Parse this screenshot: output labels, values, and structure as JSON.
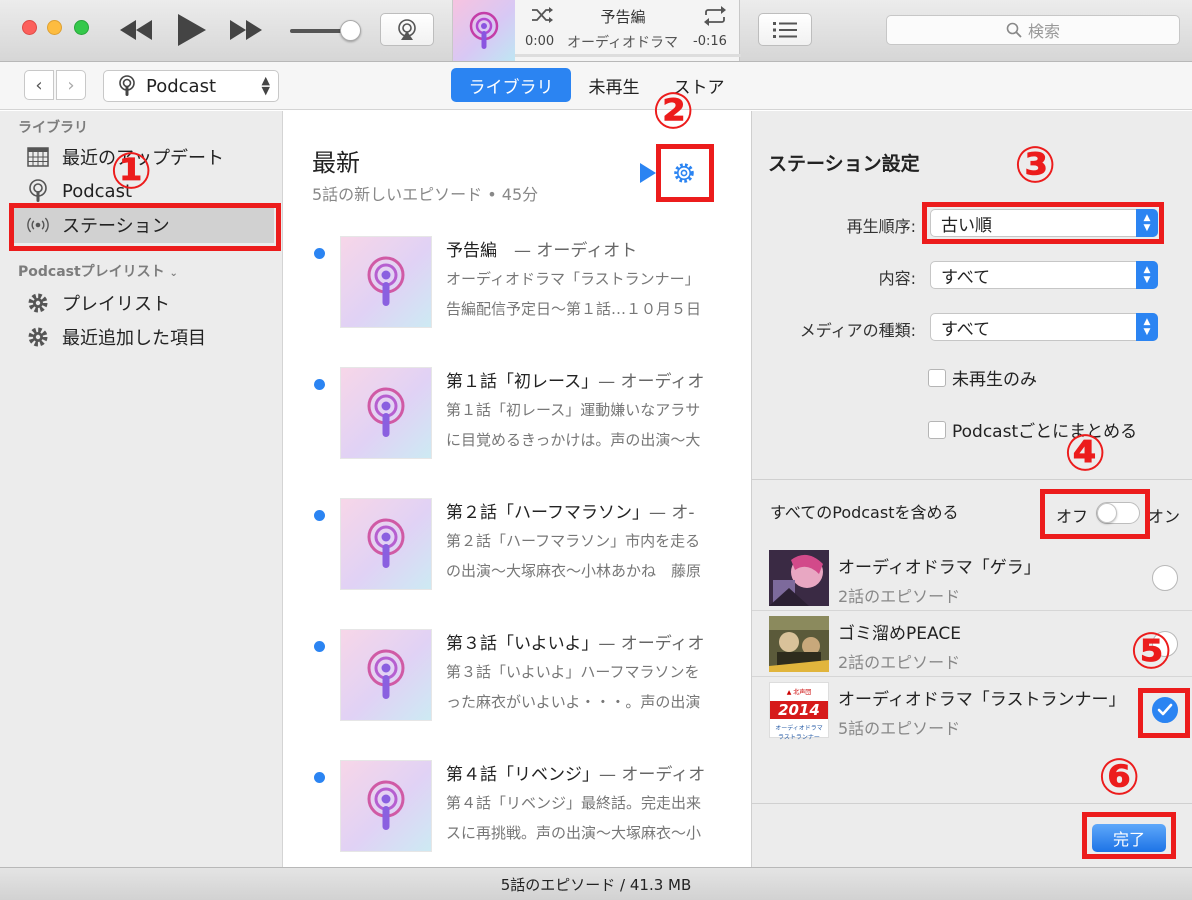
{
  "titlebar": {
    "lcd": {
      "title": "予告編",
      "subtitle": "オーディオドラマ",
      "time_elapsed": "0:00",
      "time_remaining": "-0:16",
      "progress": 0.0
    },
    "search_placeholder": "検索"
  },
  "navbar": {
    "media_type": "Podcast",
    "tabs": [
      {
        "label": "ライブラリ",
        "selected": true
      },
      {
        "label": "未再生",
        "selected": false
      },
      {
        "label": "ストア",
        "selected": false
      }
    ]
  },
  "sidebar": {
    "library_heading": "ライブラリ",
    "items": [
      {
        "label": "最近のアップデート",
        "icon": "calendar-grid-icon"
      },
      {
        "label": "Podcast",
        "icon": "podcast-icon"
      },
      {
        "label": "ステーション",
        "icon": "station-icon",
        "selected": true
      }
    ],
    "playlist_heading": "Podcastプレイリスト",
    "playlists": [
      {
        "label": "プレイリスト",
        "icon": "gear-icon"
      },
      {
        "label": "最近追加した項目",
        "icon": "gear-icon"
      }
    ]
  },
  "content": {
    "title": "最新",
    "subtitle": "5話の新しいエピソード • 45分",
    "episodes": [
      {
        "title": "予告編",
        "show": "— オーディオト",
        "desc1": "オーディオドラマ「ラストランナー」",
        "desc2": "告編配信予定日〜第１話…１０月５日"
      },
      {
        "title": "第１話「初レース」",
        "show": "— オーディオ",
        "desc1": "第１話「初レース」運動嫌いなアラサ",
        "desc2": "に目覚めるきっかけは。声の出演〜大"
      },
      {
        "title": "第２話「ハーフマラソン」",
        "show": "— オ-",
        "desc1": "第２話「ハーフマラソン」市内を走る",
        "desc2": "の出演〜大塚麻衣〜小林あかね　藤原"
      },
      {
        "title": "第３話「いよいよ」",
        "show": "— オーディオ",
        "desc1": "第３話「いよいよ」ハーフマラソンを",
        "desc2": "った麻衣がいよいよ・・・。声の出演"
      },
      {
        "title": "第４話「リベンジ」",
        "show": "— オーディオ",
        "desc1": "第４話「リベンジ」最終話。完走出来",
        "desc2": "スに再挑戦。声の出演〜大塚麻衣〜小"
      }
    ]
  },
  "panel": {
    "title": "ステーション設定",
    "fields": [
      {
        "label": "再生順序:",
        "value": "古い順"
      },
      {
        "label": "内容:",
        "value": "すべて"
      },
      {
        "label": "メディアの種類:",
        "value": "すべて"
      }
    ],
    "checkboxes": [
      {
        "label": "未再生のみ",
        "checked": false
      },
      {
        "label": "Podcastごとにまとめる",
        "checked": false
      }
    ],
    "include_all_label": "すべてのPodcastを含める",
    "toggle_off": "オフ",
    "toggle_on": "オン",
    "podcasts": [
      {
        "name": "オーディオドラマ「ゲラ」",
        "count": "2話のエピソード",
        "checked": false
      },
      {
        "name": "ゴミ溜めPEACE",
        "count": "2話のエピソード",
        "checked": false
      },
      {
        "name": "オーディオドラマ「ラストランナー」",
        "count": "5話のエピソード",
        "checked": true,
        "art_text": "2014"
      }
    ],
    "done_label": "完了"
  },
  "statusbar": {
    "text": "5話のエピソード / 41.3 MB"
  },
  "annotations": [
    "①",
    "②",
    "③",
    "④",
    "⑤",
    "⑥"
  ],
  "colors": {
    "accent": "#2b84f2",
    "annotation": "#ec1c1c"
  }
}
